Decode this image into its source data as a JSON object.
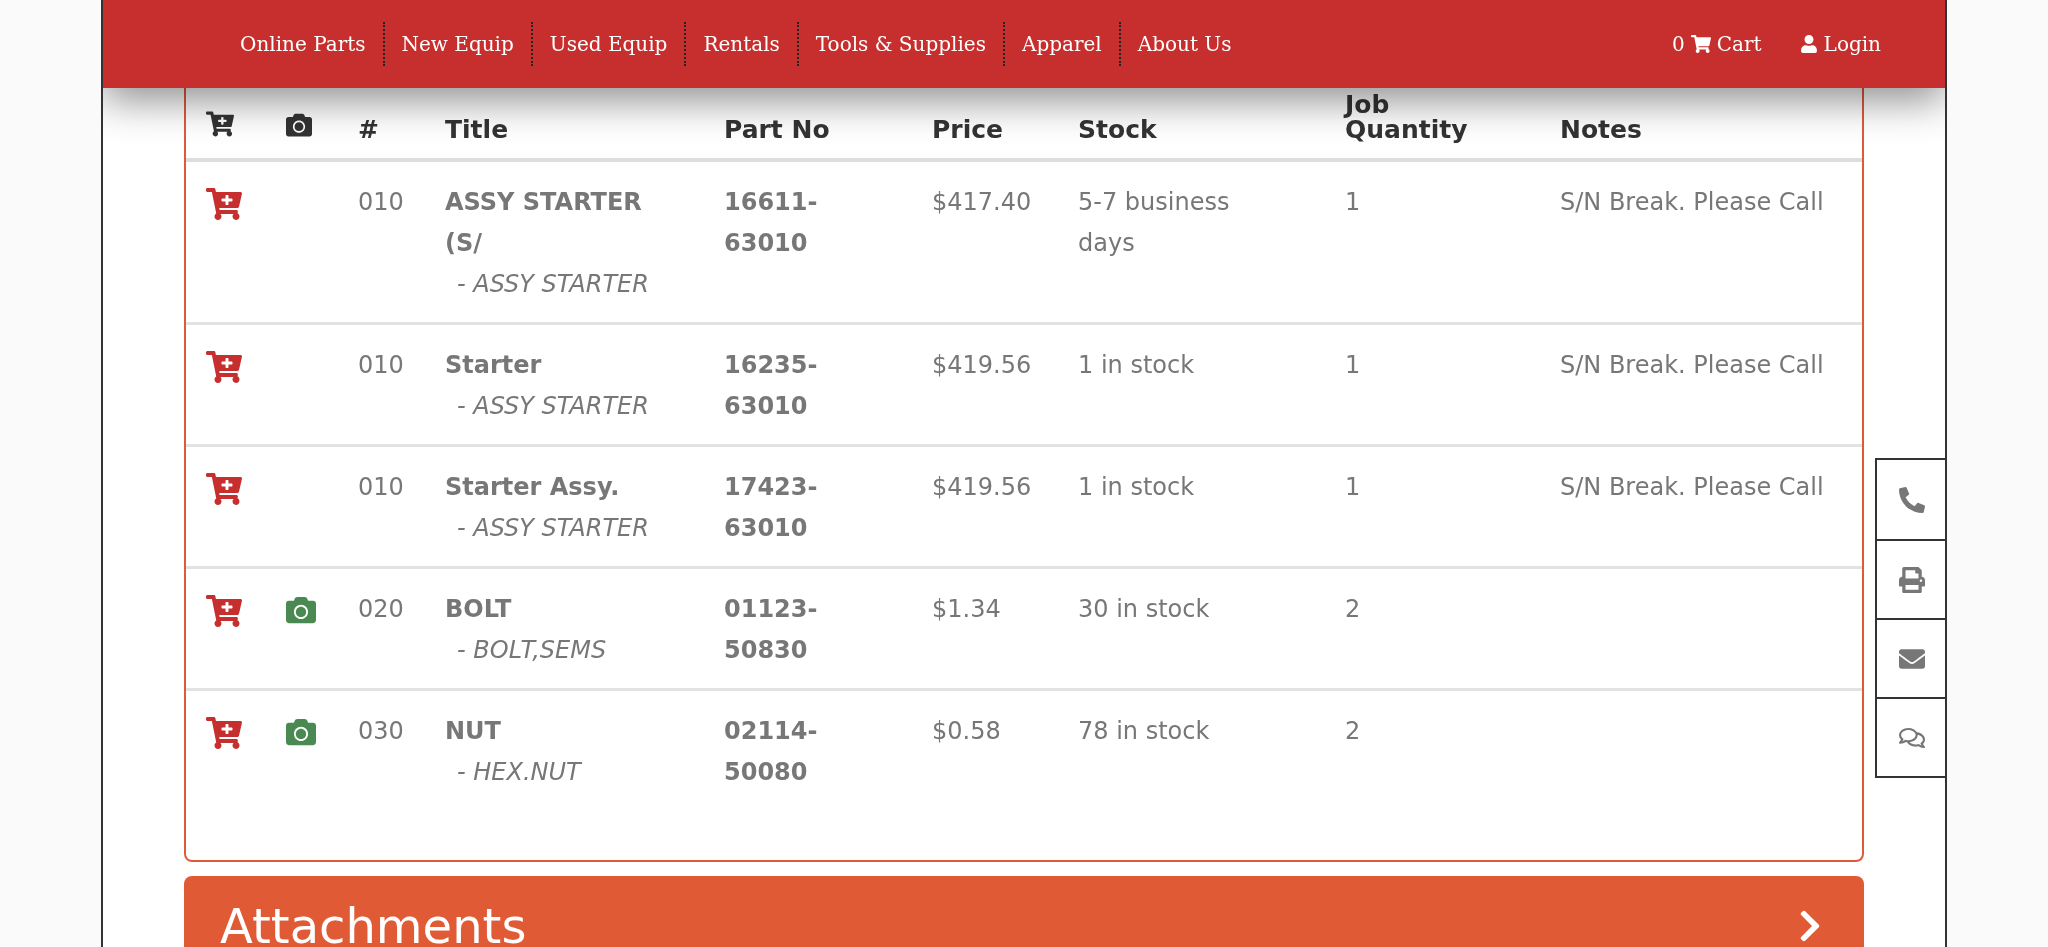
{
  "nav": {
    "items": [
      "Online Parts",
      "New Equip",
      "Used Equip",
      "Rentals",
      "Tools & Supplies",
      "Apparel",
      "About Us"
    ],
    "cart_count": "0",
    "cart": "Cart",
    "login": "Login"
  },
  "table": {
    "columns": [
      {
        "kind": "cart"
      },
      {
        "kind": "camera"
      },
      {
        "kind": "text",
        "label": "#"
      },
      {
        "kind": "text",
        "label": "Title"
      },
      {
        "kind": "text",
        "label": "Part No"
      },
      {
        "kind": "text",
        "label": "Price"
      },
      {
        "kind": "text",
        "label": "Stock"
      },
      {
        "kind": "text",
        "label": "Quantity",
        "above": "Job"
      },
      {
        "kind": "text",
        "label": "Notes"
      }
    ],
    "rows": [
      {
        "has_photo": false,
        "ref": "010",
        "title": "ASSY STARTER (S/",
        "subtitle": "- ASSY STARTER",
        "part_no": "16611-63010",
        "price": "$417.40",
        "stock": "5-7 business days",
        "quantity": "1",
        "notes": "S/N Break. Please Call"
      },
      {
        "has_photo": false,
        "ref": "010",
        "title": "Starter",
        "subtitle": "- ASSY STARTER",
        "part_no": "16235-63010",
        "price": "$419.56",
        "stock": "1 in stock",
        "quantity": "1",
        "notes": "S/N Break. Please Call"
      },
      {
        "has_photo": false,
        "ref": "010",
        "title": "Starter Assy.",
        "subtitle": "- ASSY STARTER",
        "part_no": "17423-63010",
        "price": "$419.56",
        "stock": "1 in stock",
        "quantity": "1",
        "notes": "S/N Break. Please Call"
      },
      {
        "has_photo": true,
        "ref": "020",
        "title": "BOLT",
        "subtitle": "- BOLT,SEMS",
        "part_no": "01123-50830",
        "price": "$1.34",
        "stock": "30 in stock",
        "quantity": "2"
      },
      {
        "has_photo": true,
        "ref": "030",
        "title": "NUT",
        "subtitle": "- HEX.NUT",
        "part_no": "02114-50080",
        "price": "$0.58",
        "stock": "78 in stock",
        "quantity": "2"
      }
    ]
  },
  "attachments": {
    "title": "Attachments"
  }
}
